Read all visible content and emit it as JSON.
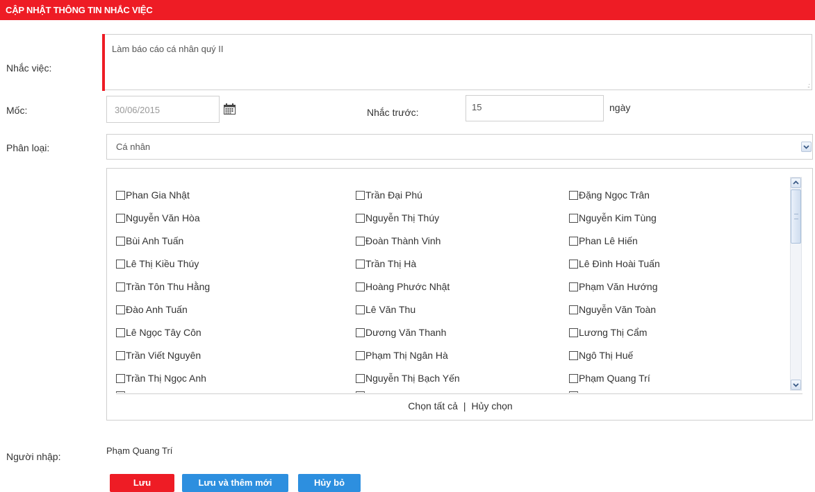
{
  "header": {
    "title": "CẬP NHẬT THÔNG TIN NHẮC VIỆC"
  },
  "form": {
    "reminder_label": "Nhắc việc:",
    "reminder_value": "Làm báo cáo cá nhân quý II",
    "milestone_label": "Mốc:",
    "milestone_value": "30/06/2015",
    "remind_before_label": "Nhắc trước:",
    "remind_before_value": "15",
    "remind_before_unit": "ngày",
    "category_label": "Phân loại:",
    "category_value": "Cá nhân",
    "creator_label": "Người nhập:",
    "creator_value": "Phạm Quang Trí"
  },
  "people": {
    "columns": [
      [
        "Phan Gia Nhật",
        "Nguyễn Văn Hòa",
        "Bùi Anh Tuấn",
        "Lê Thị Kiều Thúy",
        "Trần Tôn Thu Hằng",
        "Đào Anh Tuấn",
        "Lê Ngọc Tây Côn",
        "Trần Viết Nguyên",
        "Trần Thị Ngọc Anh"
      ],
      [
        "Trần Đại Phú",
        "Nguyễn Thị Thúy",
        "Đoàn Thành Vinh",
        "Trần Thị Hà",
        "Hoàng Phước Nhật",
        "Lê Văn Thu",
        "Dương Văn Thanh",
        "Phạm Thị Ngân Hà",
        "Nguyễn Thị Bạch Yến"
      ],
      [
        "Đặng Ngọc Trân",
        "Nguyễn Kim Tùng",
        "Phan Lê Hiến",
        "Lê Đình Hoài Tuấn",
        "Phạm Văn Hướng",
        "Nguyễn Văn Toàn",
        "Lương Thị Cẩm",
        "Ngô Thị Huế",
        "Phạm Quang Trí"
      ]
    ],
    "select_all": "Chọn tất cả",
    "separator": "|",
    "deselect": "Hủy chọn"
  },
  "buttons": {
    "save": "Lưu",
    "save_and_new": "Lưu và thêm mới",
    "cancel": "Hủy bỏ"
  },
  "colors": {
    "header": "#ee1c25",
    "primary_button": "#2d8fdf",
    "danger_button": "#ee1c25"
  }
}
